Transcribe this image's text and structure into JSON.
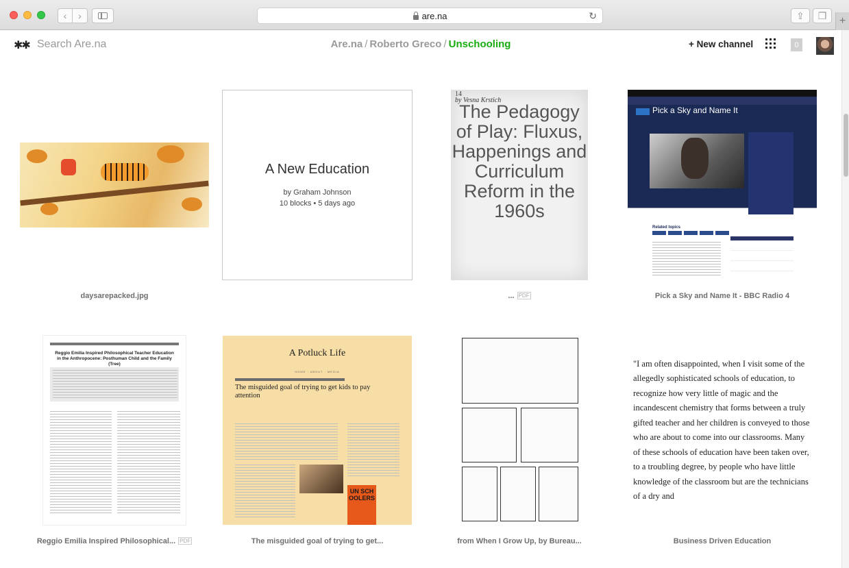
{
  "browser": {
    "url": "are.na"
  },
  "header": {
    "logo": "✱✱",
    "search_placeholder": "Search Are.na",
    "breadcrumb": [
      "Are.na",
      "Roberto Greco",
      "Unschooling"
    ],
    "new_channel": "+ New channel",
    "notification_count": "0"
  },
  "blocks": [
    {
      "caption": "daysarepacked.jpg"
    },
    {
      "title": "A New Education",
      "author": "by Graham Johnson",
      "meta": "10 blocks • 5 days ago"
    },
    {
      "caption": "...",
      "pdf_page": "14",
      "pdf_author": "by Vesna Krstich",
      "pdf_title": "The Pedagogy of Play: Fluxus, Happenings and Curriculum Reform in the 1960s"
    },
    {
      "caption": "Pick a Sky and Name It - BBC Radio 4",
      "bbc_title": "Pick a Sky and Name It",
      "bbc_section": "Related topics"
    },
    {
      "caption": "Reggio Emilia Inspired Philosophical...",
      "paper_title": "Reggio Emilia Inspired Philosophical Teacher Education in the Anthropocene: Posthuman Child and the Family (Tree)"
    },
    {
      "caption": "The misguided goal of trying to get...",
      "site_name": "A Potluck Life",
      "headline": "The misguided goal of trying to get kids to pay attention",
      "book_text": "UN SCH OOLERS"
    },
    {
      "caption": "from When I Grow Up, by Bureau..."
    },
    {
      "caption": "Business Driven Education",
      "quote": "\"I am often disappointed, when I visit some of the allegedly sophisticated schools of education, to recognize how very little of magic and the incandescent chemistry that forms between a truly gifted teacher and her children is conveyed to those who are about to come into our classrooms. Many of these schools of education have been taken over, to a troubling degree, by people who have little knowledge of the classroom but are the technicians of a dry and"
    }
  ]
}
